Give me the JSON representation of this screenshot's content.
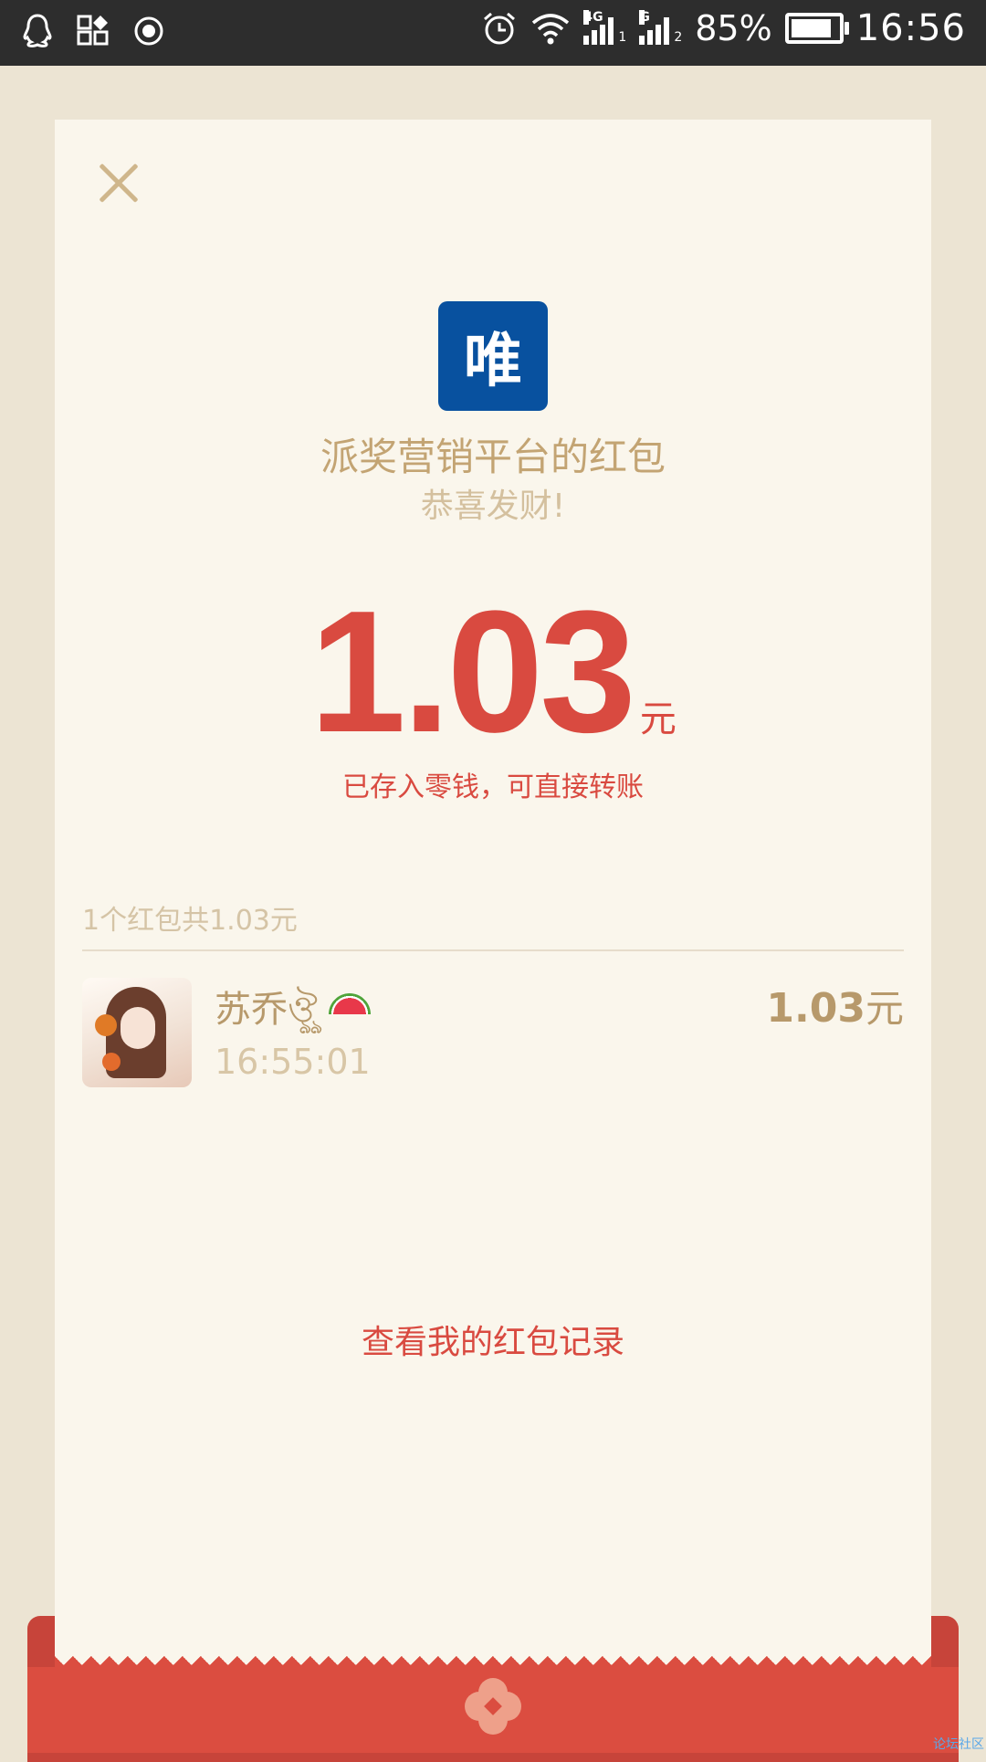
{
  "status_bar": {
    "left_icons": [
      "qq-icon",
      "apps-icon",
      "record-icon"
    ],
    "right_icons": [
      "alarm-icon",
      "wifi-icon",
      "signal-4g-icon",
      "signal-g-icon"
    ],
    "signal_1_tag": "4G",
    "signal_1_sub": "1",
    "signal_2_tag": "G",
    "signal_2_sub": "2",
    "battery_percent_text": "85%",
    "battery_level": 0.85,
    "time": "16:56"
  },
  "card": {
    "close_icon": "close-icon",
    "logo_char": "唯",
    "logo_color": "#08519f",
    "sender_title": "派奖营销平台的红包",
    "greeting": "恭喜发财!",
    "amount_value": "1.03",
    "amount_unit": "元",
    "amount_note": "已存入零钱，可直接转账",
    "summary": "1个红包共1.03元",
    "records": [
      {
        "name": "苏乔ঔৣ",
        "emoji_icon": "watermelon-icon",
        "time": "16:55:01",
        "amount": "1.03",
        "unit": "元"
      }
    ],
    "history_link": "查看我的红包记录"
  },
  "envelope": {
    "emblem_icon": "flower-emblem-icon",
    "accent_color": "#db4d40"
  },
  "watermark": "论坛社区"
}
